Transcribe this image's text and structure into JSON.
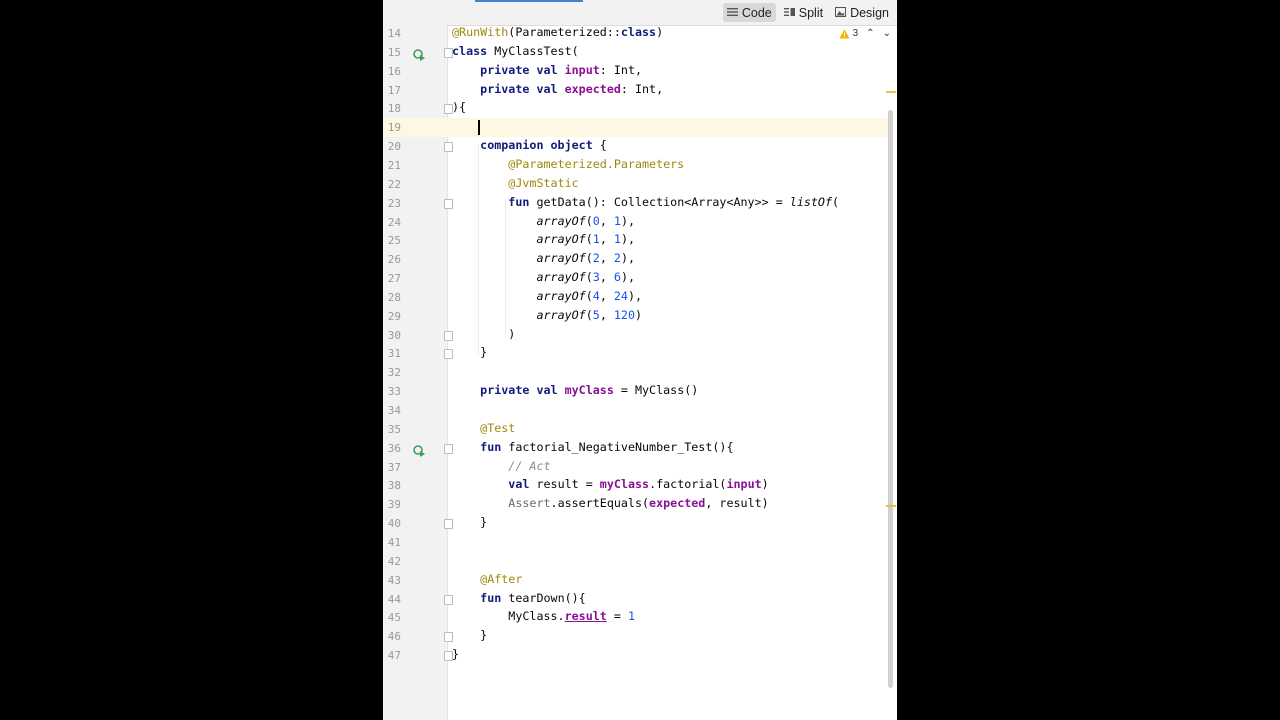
{
  "toolbar": {
    "modes": [
      {
        "label": "Code",
        "icon": "code-view-icon",
        "active": true
      },
      {
        "label": "Split",
        "icon": "split-view-icon",
        "active": false
      },
      {
        "label": "Design",
        "icon": "design-view-icon",
        "active": false
      }
    ]
  },
  "inspection": {
    "warning_count": "3"
  },
  "current_line": "19",
  "lines": [
    {
      "n": "14",
      "segments": [
        [
          "ann",
          "@RunWith"
        ],
        [
          "",
          "(Parameterized::"
        ],
        [
          "kwb",
          "class"
        ],
        [
          "",
          ")"
        ]
      ]
    },
    {
      "n": "15",
      "segments": [
        [
          "kwb",
          "class"
        ],
        [
          "",
          " MyClassTest("
        ]
      ]
    },
    {
      "n": "16",
      "segments": [
        [
          "",
          "    "
        ],
        [
          "kwb",
          "private val"
        ],
        [
          "",
          " "
        ],
        [
          "prop",
          "input"
        ],
        [
          "",
          ": Int,"
        ]
      ]
    },
    {
      "n": "17",
      "segments": [
        [
          "",
          "    "
        ],
        [
          "kwb",
          "private val"
        ],
        [
          "",
          " "
        ],
        [
          "prop",
          "expected"
        ],
        [
          "",
          ": Int,"
        ]
      ]
    },
    {
      "n": "18",
      "segments": [
        [
          "",
          "){"
        ]
      ]
    },
    {
      "n": "19",
      "segments": [
        [
          "",
          ""
        ]
      ]
    },
    {
      "n": "20",
      "segments": [
        [
          "",
          "    "
        ],
        [
          "kwb",
          "companion object"
        ],
        [
          "",
          " {"
        ]
      ]
    },
    {
      "n": "21",
      "segments": [
        [
          "",
          "        "
        ],
        [
          "ann",
          "@Parameterized.Parameters"
        ]
      ]
    },
    {
      "n": "22",
      "segments": [
        [
          "",
          "        "
        ],
        [
          "ann",
          "@JvmStatic"
        ]
      ]
    },
    {
      "n": "23",
      "segments": [
        [
          "",
          "        "
        ],
        [
          "kwb",
          "fun"
        ],
        [
          "",
          " getData(): Collection<Array<Any>> = "
        ],
        [
          "fn-it",
          "listOf"
        ],
        [
          "",
          "("
        ]
      ]
    },
    {
      "n": "24",
      "segments": [
        [
          "",
          "            "
        ],
        [
          "fn-it",
          "arrayOf"
        ],
        [
          "",
          "("
        ],
        [
          "num",
          "0"
        ],
        [
          "",
          ", "
        ],
        [
          "num",
          "1"
        ],
        [
          "",
          "),"
        ]
      ]
    },
    {
      "n": "25",
      "segments": [
        [
          "",
          "            "
        ],
        [
          "fn-it",
          "arrayOf"
        ],
        [
          "",
          "("
        ],
        [
          "num",
          "1"
        ],
        [
          "",
          ", "
        ],
        [
          "num",
          "1"
        ],
        [
          "",
          "),"
        ]
      ]
    },
    {
      "n": "26",
      "segments": [
        [
          "",
          "            "
        ],
        [
          "fn-it",
          "arrayOf"
        ],
        [
          "",
          "("
        ],
        [
          "num",
          "2"
        ],
        [
          "",
          ", "
        ],
        [
          "num",
          "2"
        ],
        [
          "",
          "),"
        ]
      ]
    },
    {
      "n": "27",
      "segments": [
        [
          "",
          "            "
        ],
        [
          "fn-it",
          "arrayOf"
        ],
        [
          "",
          "("
        ],
        [
          "num",
          "3"
        ],
        [
          "",
          ", "
        ],
        [
          "num",
          "6"
        ],
        [
          "",
          "),"
        ]
      ]
    },
    {
      "n": "28",
      "segments": [
        [
          "",
          "            "
        ],
        [
          "fn-it",
          "arrayOf"
        ],
        [
          "",
          "("
        ],
        [
          "num",
          "4"
        ],
        [
          "",
          ", "
        ],
        [
          "num",
          "24"
        ],
        [
          "",
          "),"
        ]
      ]
    },
    {
      "n": "29",
      "segments": [
        [
          "",
          "            "
        ],
        [
          "fn-it",
          "arrayOf"
        ],
        [
          "",
          "("
        ],
        [
          "num",
          "5"
        ],
        [
          "",
          ", "
        ],
        [
          "num",
          "120"
        ],
        [
          "",
          ")"
        ]
      ]
    },
    {
      "n": "30",
      "segments": [
        [
          "",
          "        )"
        ]
      ]
    },
    {
      "n": "31",
      "segments": [
        [
          "",
          "    }"
        ]
      ]
    },
    {
      "n": "32",
      "segments": [
        [
          "",
          ""
        ]
      ]
    },
    {
      "n": "33",
      "segments": [
        [
          "",
          "    "
        ],
        [
          "kwb",
          "private val"
        ],
        [
          "",
          " "
        ],
        [
          "prop",
          "myClass"
        ],
        [
          "",
          " = MyClass()"
        ]
      ]
    },
    {
      "n": "34",
      "segments": [
        [
          "",
          ""
        ]
      ]
    },
    {
      "n": "35",
      "segments": [
        [
          "",
          "    "
        ],
        [
          "ann",
          "@Test"
        ]
      ]
    },
    {
      "n": "36",
      "segments": [
        [
          "",
          "    "
        ],
        [
          "kwb",
          "fun"
        ],
        [
          "",
          " factorial_NegativeNumber_Test(){"
        ]
      ]
    },
    {
      "n": "37",
      "segments": [
        [
          "",
          "        "
        ],
        [
          "comment",
          "// Act"
        ]
      ]
    },
    {
      "n": "38",
      "segments": [
        [
          "",
          "        "
        ],
        [
          "kwb",
          "val"
        ],
        [
          "",
          " result = "
        ],
        [
          "prop",
          "myClass"
        ],
        [
          "",
          ".factorial("
        ],
        [
          "prop",
          "input"
        ],
        [
          "",
          ")"
        ]
      ]
    },
    {
      "n": "39",
      "segments": [
        [
          "",
          "        "
        ],
        [
          "gray",
          "Assert"
        ],
        [
          "",
          ".assertEquals("
        ],
        [
          "prop",
          "expected"
        ],
        [
          "",
          ", result)"
        ]
      ]
    },
    {
      "n": "40",
      "segments": [
        [
          "",
          "    }"
        ]
      ]
    },
    {
      "n": "41",
      "segments": [
        [
          "",
          ""
        ]
      ]
    },
    {
      "n": "42",
      "segments": [
        [
          "",
          ""
        ]
      ]
    },
    {
      "n": "43",
      "segments": [
        [
          "",
          "    "
        ],
        [
          "ann",
          "@After"
        ]
      ]
    },
    {
      "n": "44",
      "segments": [
        [
          "",
          "    "
        ],
        [
          "kwb",
          "fun"
        ],
        [
          "",
          " tearDown(){"
        ]
      ]
    },
    {
      "n": "45",
      "segments": [
        [
          "",
          "        MyClass."
        ],
        [
          "uline",
          "result"
        ],
        [
          "",
          " = "
        ],
        [
          "num",
          "1"
        ]
      ]
    },
    {
      "n": "46",
      "segments": [
        [
          "",
          "    }"
        ]
      ]
    },
    {
      "n": "47",
      "segments": [
        [
          "",
          "}"
        ]
      ]
    }
  ],
  "fold_lines": [
    "15",
    "18",
    "20",
    "23",
    "30",
    "31",
    "36",
    "40",
    "44",
    "46",
    "47"
  ],
  "run_lines": [
    "15",
    "36"
  ],
  "marker_lines": [
    "17",
    "39"
  ]
}
